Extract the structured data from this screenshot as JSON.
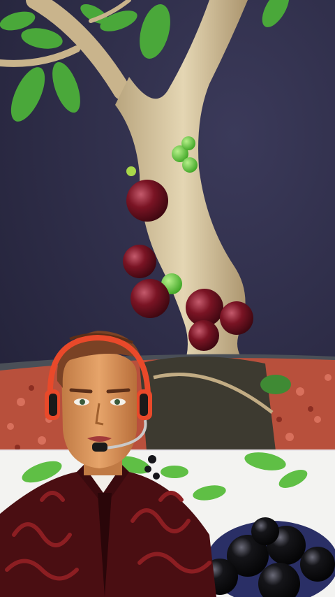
{
  "scene": {
    "top_panel": "bonsai-jabuticaba-tree-with-fruit",
    "bottom_panel": "small-jabuticaba-tree-and-berry-bowl",
    "overlay": "cartoon-avatar-with-headset"
  },
  "colors": {
    "backdrop": "#2f2d4a",
    "trunk": "#d9c9a4",
    "fruit": "#7a1424",
    "unripe_fruit": "#5fcf3a",
    "leaf": "#4aa83a",
    "soil": "#c0503c",
    "pot": "#4a4f57",
    "jacket": "#4a0e12",
    "headset": "#e9492a",
    "skin": "#d9925a"
  }
}
